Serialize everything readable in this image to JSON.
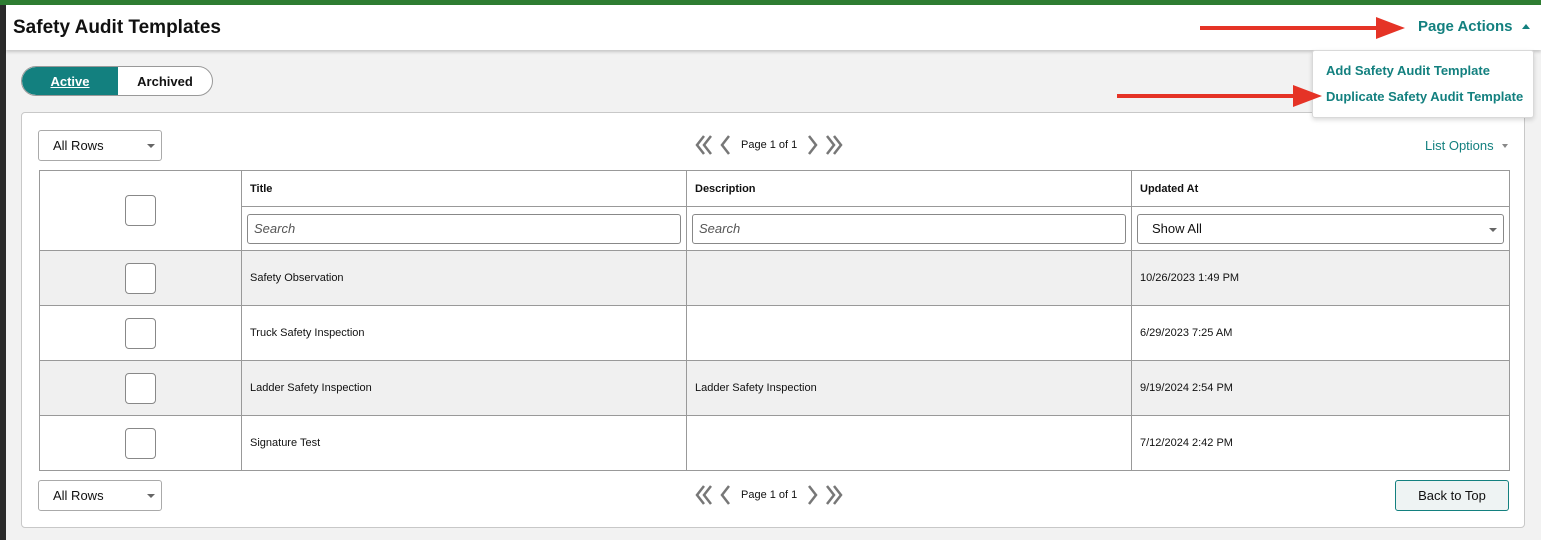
{
  "header": {
    "title": "Safety Audit Templates",
    "page_actions_label": "Page Actions"
  },
  "page_actions_menu": {
    "items": [
      {
        "label": "Add Safety Audit Template"
      },
      {
        "label": "Duplicate Safety Audit Template"
      }
    ]
  },
  "status_toggle": {
    "active_label": "Active",
    "archived_label": "Archived",
    "selected": "Active"
  },
  "pagination_top": {
    "rows_select": "All Rows",
    "page_text": "Page 1 of 1"
  },
  "pagination_bottom": {
    "rows_select": "All Rows",
    "page_text": "Page 1 of 1"
  },
  "list_options_label": "List Options",
  "table": {
    "columns": [
      "Title",
      "Description",
      "Updated At"
    ],
    "filters": {
      "title_placeholder": "Search",
      "description_placeholder": "Search",
      "updated_at_select": "Show All"
    },
    "rows": [
      {
        "title": "Safety Observation",
        "description": "",
        "updated_at": "10/26/2023 1:49 PM"
      },
      {
        "title": "Truck Safety Inspection",
        "description": "",
        "updated_at": "6/29/2023 7:25 AM"
      },
      {
        "title": "Ladder Safety Inspection",
        "description": "Ladder Safety Inspection",
        "updated_at": "9/19/2024 2:54 PM"
      },
      {
        "title": "Signature Test",
        "description": "",
        "updated_at": "7/12/2024 2:42 PM"
      }
    ]
  },
  "back_to_top_label": "Back to Top",
  "colors": {
    "accent": "#13807f",
    "top_bar": "#2e7d32",
    "annotation_arrow": "#e53326"
  }
}
